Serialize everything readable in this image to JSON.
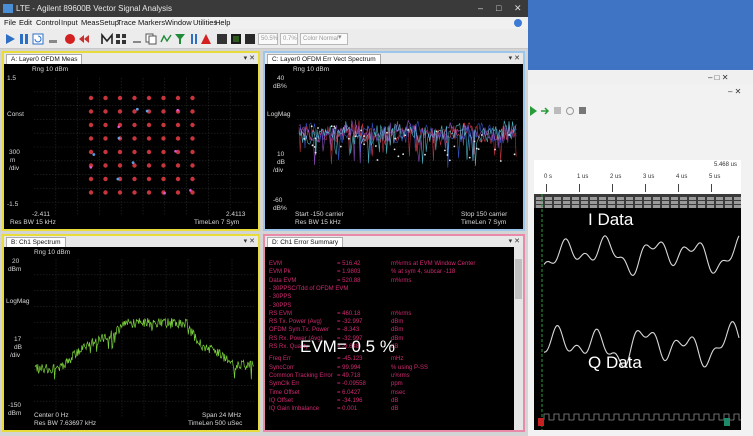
{
  "window": {
    "title": "LTE - Agilent 89600B Vector Signal Analysis",
    "controls": [
      "–",
      "□",
      "✕"
    ]
  },
  "menu": [
    "File",
    "Edit",
    "Control",
    "Input",
    "MeasSetup",
    "Trace",
    "Markers",
    "Window",
    "Utilities",
    "Help"
  ],
  "toolbar": {
    "zoom_field": "50.5%",
    "pct_field": "0.7%",
    "color_select": "Color Normal"
  },
  "panels": {
    "A": {
      "tab": "A: Layer0 OFDM Meas",
      "ref": "Rng 10 dBm",
      "y_top": "1.5",
      "y_name": "Const",
      "y_scale": [
        "300",
        "m",
        "/div"
      ],
      "y_bottom": "-1.5",
      "x_left": "-2.411",
      "x_right": "2.4113",
      "footer_left": "Res BW 15 kHz",
      "footer_right": "TimeLen 7  Sym"
    },
    "B": {
      "tab": "B: Ch1 Spectrum",
      "ref": "Rng 10 dBm",
      "y_top": [
        "20",
        "dBm"
      ],
      "y_name": "LogMag",
      "y_scale": [
        "17",
        "dB",
        "/div"
      ],
      "y_bottom": [
        "-150",
        "dBm"
      ],
      "x_left": "Center 0  Hz",
      "x_right": "Span 24  MHz",
      "footer_left": "Res BW 7.63697 kHz",
      "footer_right": "TimeLen 500 uSec"
    },
    "C": {
      "tab": "C: Layer0 OFDM Err Vect Spectrum",
      "ref": "Rng 10 dBm",
      "y_top": [
        "40",
        "dB%"
      ],
      "y_name": "LogMag",
      "y_scale": [
        "10",
        "dB",
        "/div"
      ],
      "y_bottom": [
        "-60",
        "dB%"
      ],
      "x_left": "Start -150  carrier",
      "x_right": "Stop 150  carrier",
      "footer_left": "Res BW 15 kHz",
      "footer_right": "TimeLen 7  Sym"
    },
    "D": {
      "tab": "D: Ch1 Error Summary",
      "rows": [
        [
          "EVM",
          "= 516.42",
          "m%rms  at  EVM Window Center"
        ],
        [
          "EVM Pk",
          "= 1.9803",
          "%  at  sym 4,  subcar  -118"
        ],
        [
          "Data EVM",
          "= 520.88",
          "m%rms"
        ],
        [
          "- 30PPSC/Tdd of OFDM EVM",
          "",
          ""
        ],
        [
          "- 30PPS",
          "",
          ""
        ],
        [
          "- 30PPS",
          "",
          ""
        ],
        [
          "RS EVM",
          "= 460.18",
          "m%rms"
        ],
        [
          "RS Tx. Power (Avg)",
          "= -32.997",
          "dBm"
        ],
        [
          "OFDM Sym.Tx. Power",
          "= -8.343",
          "dBm"
        ],
        [
          "RS Rx. Power (Avg)",
          "= -32.997",
          "dBm"
        ],
        [
          "RS Rx. Quality",
          "= -9.648",
          "dB"
        ],
        [
          "Freq Err",
          "= -45.123",
          "mHz"
        ],
        [
          "SyncCorr",
          "= 99.994",
          "%  using  P-SS"
        ],
        [
          "Common Tracking Error",
          "= 49.718",
          "u%rms"
        ],
        [
          "SymClk Err",
          "= -0.09558",
          "ppm"
        ],
        [
          "Time Offset",
          "= 6.0427",
          "msec"
        ],
        [
          "IQ Offset",
          "= -34.196",
          "dB"
        ],
        [
          "IQ Gain Imbalance",
          "= 0.001",
          "dB"
        ]
      ]
    }
  },
  "overlay": {
    "evm": "EVM= 0.5 %",
    "i_data": "I Data",
    "q_data": "Q Data"
  },
  "second_app": {
    "time_readout": "5.468 us",
    "ruler": [
      "0 s",
      "1 us",
      "2 us",
      "3 us",
      "4 us",
      "5 us"
    ]
  },
  "colors": {
    "panel_a_border": "#e8dc3a",
    "panel_b_border": "#e8dc3a",
    "panel_c_border": "#9cc6ea",
    "panel_d_border": "#e88aa8",
    "constellation": "#c8343c",
    "spectrum": "#7cd33c",
    "summary_text": "#cf2a6f",
    "desktop": "#3f73c4"
  }
}
